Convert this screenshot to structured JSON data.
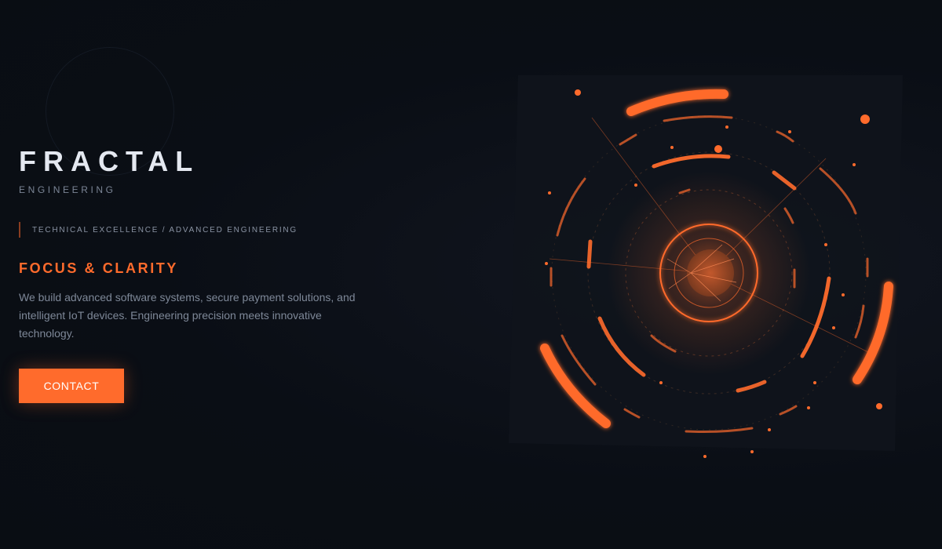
{
  "brand": {
    "name": "FRACTAL",
    "subtitle": "ENGINEERING"
  },
  "tagline": "TECHNICAL EXCELLENCE / ADVANCED ENGINEERING",
  "headline": "FOCUS & CLARITY",
  "description": "We build advanced software systems, secure payment solutions, and intelligent IoT devices. Engineering precision meets innovative technology.",
  "cta": {
    "label": "CONTACT"
  },
  "colors": {
    "accent": "#ff6b2c",
    "background": "#0a0e15",
    "title": "#e4e8f0",
    "muted": "#7e8898"
  },
  "visual": {
    "icon": "fractal-rings-icon"
  }
}
